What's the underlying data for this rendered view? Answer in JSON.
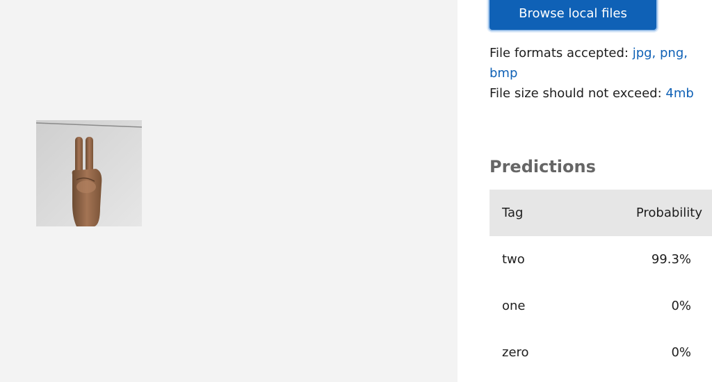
{
  "upload": {
    "browse_label": "Browse local files",
    "formats_label": "File formats accepted:",
    "formats_value": "jpg, png, bmp",
    "size_label": "File size should not exceed:",
    "size_value": "4mb"
  },
  "predictions": {
    "title": "Predictions",
    "columns": [
      "Tag",
      "Probability"
    ],
    "rows": [
      {
        "tag": "two",
        "probability": "99.3%"
      },
      {
        "tag": "one",
        "probability": "0%"
      },
      {
        "tag": "zero",
        "probability": "0%"
      }
    ]
  },
  "colors": {
    "accent": "#0f61b6",
    "left_background": "#f3f3f3",
    "header_row": "#e6e6e6"
  },
  "preview": {
    "icon": "hand-peace-photo"
  }
}
